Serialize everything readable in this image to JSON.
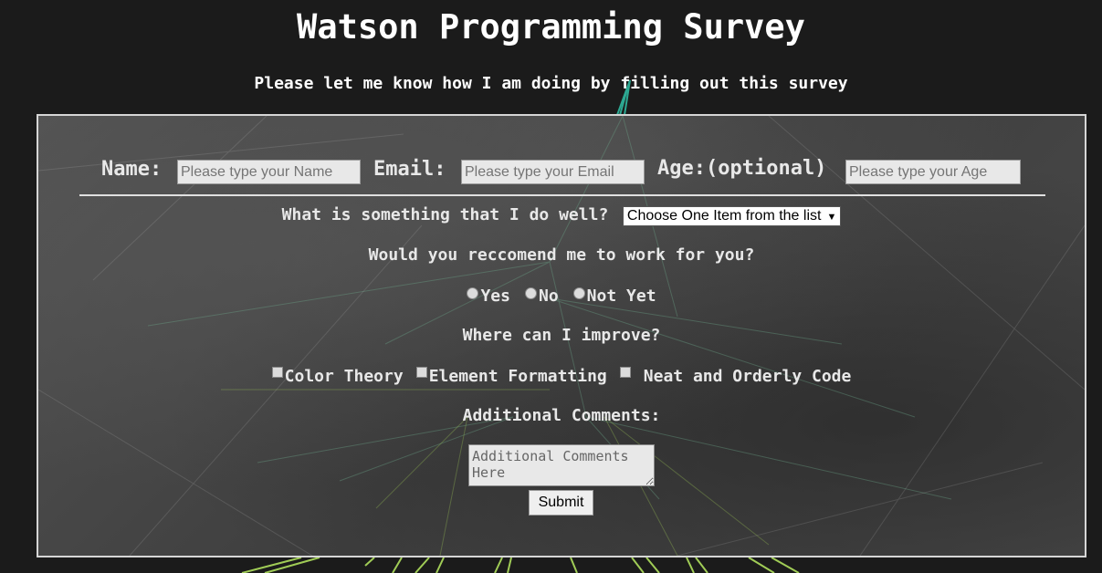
{
  "page": {
    "title": "Watson Programming Survey",
    "subtitle": "Please let me know how I am doing by filling out this survey"
  },
  "form": {
    "name_label": "Name:",
    "name_placeholder": "Please type your Name",
    "email_label": "Email:",
    "email_placeholder": "Please type your Email",
    "age_label": "Age:(optional)",
    "age_placeholder": "Please type your Age",
    "well_question": "What is something that I do well?",
    "well_select_value": "Choose One Item from the list",
    "recommend_question": "Would you reccomend me to work for you?",
    "recommend_options": [
      "Yes",
      "No",
      "Not Yet"
    ],
    "improve_question": "Where can I improve?",
    "improve_options": [
      "Color Theory",
      "Element Formatting",
      "Neat and Orderly Code"
    ],
    "comments_label": "Additional Comments:",
    "comments_placeholder": "Additional Comments Here",
    "submit_label": "Submit"
  },
  "icons": {
    "select_caret": "chevron-down-icon"
  },
  "colors": {
    "page_background": "#1b1b1b",
    "panel_border": "#d6d6d6",
    "panel_background": "#4a4a4a",
    "text": "#ffffff",
    "accent_lines_green": "#a8d65a",
    "accent_lines_teal": "#2fb9a0"
  }
}
